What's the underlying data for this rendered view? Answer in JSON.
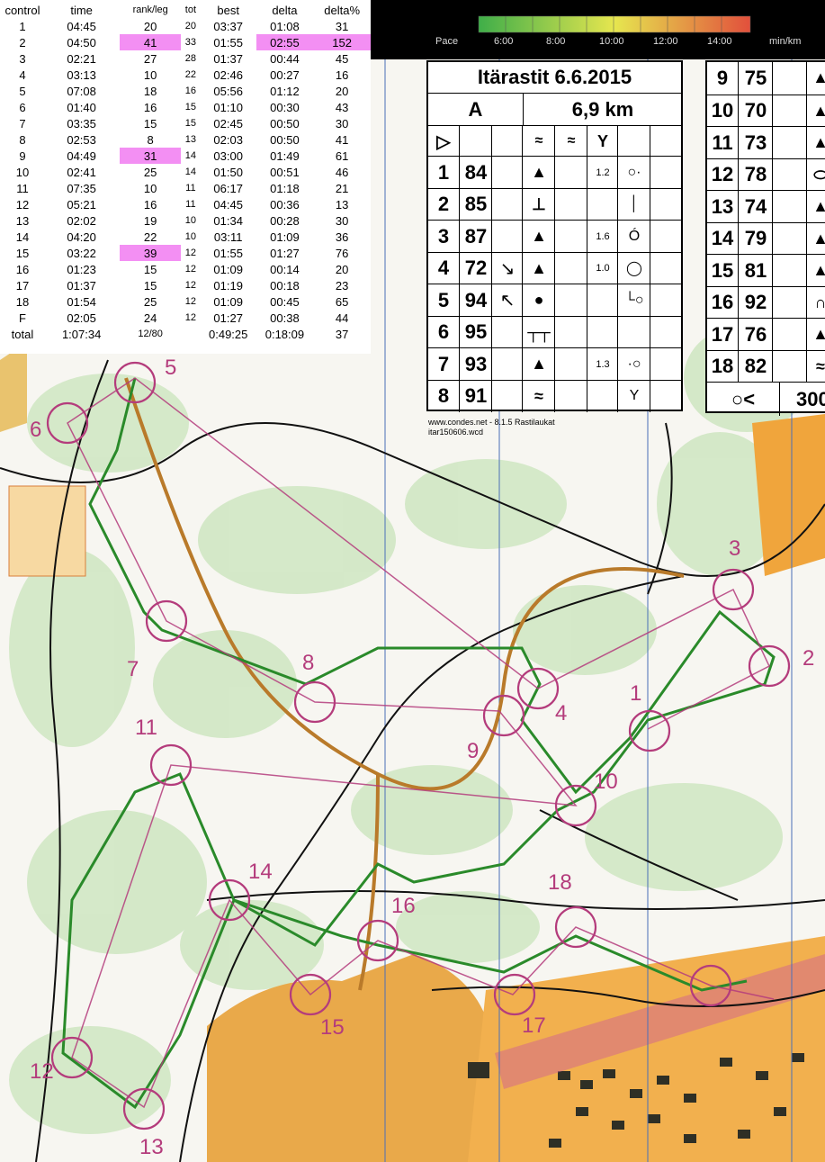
{
  "splits": {
    "headers": [
      "control",
      "time",
      "rank/leg",
      "tot",
      "best",
      "delta",
      "delta%"
    ],
    "rows": [
      {
        "control": "1",
        "time": "04:45",
        "rank": "20",
        "tot": "20",
        "best": "03:37",
        "delta": "01:08",
        "pct": "31",
        "hl": false
      },
      {
        "control": "2",
        "time": "04:50",
        "rank": "41",
        "tot": "33",
        "best": "01:55",
        "delta": "02:55",
        "pct": "152",
        "hl": true
      },
      {
        "control": "3",
        "time": "02:21",
        "rank": "27",
        "tot": "28",
        "best": "01:37",
        "delta": "00:44",
        "pct": "45",
        "hl": false
      },
      {
        "control": "4",
        "time": "03:13",
        "rank": "10",
        "tot": "22",
        "best": "02:46",
        "delta": "00:27",
        "pct": "16",
        "hl": false
      },
      {
        "control": "5",
        "time": "07:08",
        "rank": "18",
        "tot": "16",
        "best": "05:56",
        "delta": "01:12",
        "pct": "20",
        "hl": false
      },
      {
        "control": "6",
        "time": "01:40",
        "rank": "16",
        "tot": "15",
        "best": "01:10",
        "delta": "00:30",
        "pct": "43",
        "hl": false
      },
      {
        "control": "7",
        "time": "03:35",
        "rank": "15",
        "tot": "15",
        "best": "02:45",
        "delta": "00:50",
        "pct": "30",
        "hl": false
      },
      {
        "control": "8",
        "time": "02:53",
        "rank": "8",
        "tot": "13",
        "best": "02:03",
        "delta": "00:50",
        "pct": "41",
        "hl": false
      },
      {
        "control": "9",
        "time": "04:49",
        "rank": "31",
        "tot": "14",
        "best": "03:00",
        "delta": "01:49",
        "pct": "61",
        "hl": true
      },
      {
        "control": "10",
        "time": "02:41",
        "rank": "25",
        "tot": "14",
        "best": "01:50",
        "delta": "00:51",
        "pct": "46",
        "hl": false
      },
      {
        "control": "11",
        "time": "07:35",
        "rank": "10",
        "tot": "11",
        "best": "06:17",
        "delta": "01:18",
        "pct": "21",
        "hl": false
      },
      {
        "control": "12",
        "time": "05:21",
        "rank": "16",
        "tot": "11",
        "best": "04:45",
        "delta": "00:36",
        "pct": "13",
        "hl": false
      },
      {
        "control": "13",
        "time": "02:02",
        "rank": "19",
        "tot": "10",
        "best": "01:34",
        "delta": "00:28",
        "pct": "30",
        "hl": false
      },
      {
        "control": "14",
        "time": "04:20",
        "rank": "22",
        "tot": "10",
        "best": "03:11",
        "delta": "01:09",
        "pct": "36",
        "hl": false
      },
      {
        "control": "15",
        "time": "03:22",
        "rank": "39",
        "tot": "12",
        "best": "01:55",
        "delta": "01:27",
        "pct": "76",
        "hl": true
      },
      {
        "control": "16",
        "time": "01:23",
        "rank": "15",
        "tot": "12",
        "best": "01:09",
        "delta": "00:14",
        "pct": "20",
        "hl": false
      },
      {
        "control": "17",
        "time": "01:37",
        "rank": "15",
        "tot": "12",
        "best": "01:19",
        "delta": "00:18",
        "pct": "23",
        "hl": false
      },
      {
        "control": "18",
        "time": "01:54",
        "rank": "25",
        "tot": "12",
        "best": "01:09",
        "delta": "00:45",
        "pct": "65",
        "hl": false
      },
      {
        "control": "F",
        "time": "02:05",
        "rank": "24",
        "tot": "12",
        "best": "01:27",
        "delta": "00:38",
        "pct": "44",
        "hl": false
      }
    ],
    "total": {
      "control": "total",
      "time": "1:07:34",
      "rank": "12/80",
      "best": "0:49:25",
      "delta": "0:18:09",
      "pct": "37"
    }
  },
  "pace": {
    "label": "Pace",
    "ticks": [
      "6:00",
      "8:00",
      "10:00",
      "12:00",
      "14:00"
    ],
    "unit": "min/km"
  },
  "description": {
    "title": "Itärastit 6.6.2015",
    "course": "A",
    "length": "6,9 km",
    "rows_left": [
      {
        "n": "1",
        "code": "84",
        "dim": "1.2"
      },
      {
        "n": "2",
        "code": "85",
        "dim": ""
      },
      {
        "n": "3",
        "code": "87",
        "dim": "1.6"
      },
      {
        "n": "4",
        "code": "72",
        "dim": "1.0"
      },
      {
        "n": "5",
        "code": "94",
        "dim": ""
      },
      {
        "n": "6",
        "code": "95",
        "dim": ""
      },
      {
        "n": "7",
        "code": "93",
        "dim": "1.3"
      },
      {
        "n": "8",
        "code": "91",
        "dim": ""
      }
    ],
    "rows_right": [
      {
        "n": "9",
        "code": "75"
      },
      {
        "n": "10",
        "code": "70"
      },
      {
        "n": "11",
        "code": "73"
      },
      {
        "n": "12",
        "code": "78"
      },
      {
        "n": "13",
        "code": "74"
      },
      {
        "n": "14",
        "code": "79"
      },
      {
        "n": "15",
        "code": "81"
      },
      {
        "n": "16",
        "code": "92"
      },
      {
        "n": "17",
        "code": "76"
      },
      {
        "n": "18",
        "code": "82"
      }
    ],
    "finish_dist": "300",
    "footer1": "www.condes.net - 8.1.5 Rastilaukat",
    "footer2": "itar150606.wcd"
  },
  "controls": [
    {
      "label": "1"
    },
    {
      "label": "2"
    },
    {
      "label": "3"
    },
    {
      "label": "4"
    },
    {
      "label": "5"
    },
    {
      "label": "6"
    },
    {
      "label": "7"
    },
    {
      "label": "8"
    },
    {
      "label": "9"
    },
    {
      "label": "10"
    },
    {
      "label": "11"
    },
    {
      "label": "12"
    },
    {
      "label": "13"
    },
    {
      "label": "14"
    },
    {
      "label": "15"
    },
    {
      "label": "16"
    },
    {
      "label": "17"
    },
    {
      "label": "18"
    }
  ],
  "colors": {
    "course": "#b43c7c",
    "route_green": "#2a8a2a",
    "open_land": "#f5a623",
    "vegetation": "#cfe6c2",
    "urban": "#c79a55",
    "highlight": "#f38ff3"
  }
}
